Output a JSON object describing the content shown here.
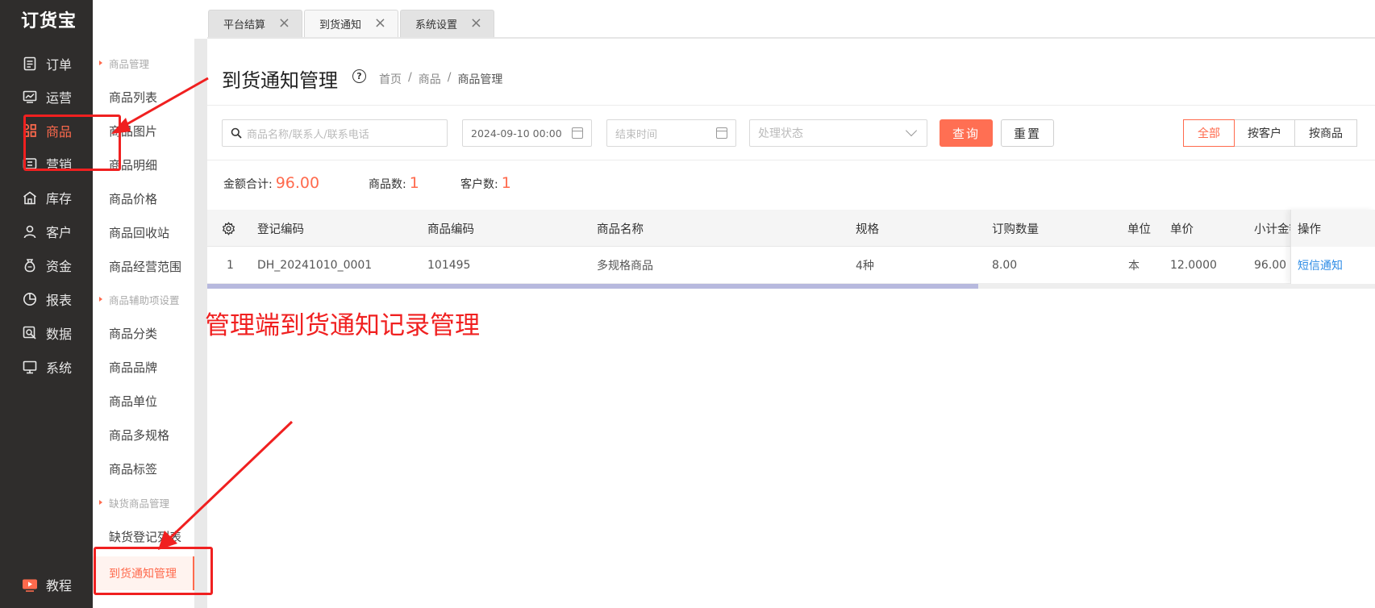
{
  "app": {
    "logo": "订货宝"
  },
  "rail": {
    "items": [
      {
        "label": "订单",
        "icon": "order-icon"
      },
      {
        "label": "运营",
        "icon": "chart-icon"
      },
      {
        "label": "商品",
        "icon": "grid-icon",
        "active": true
      },
      {
        "label": "营销",
        "icon": "marketing-icon"
      },
      {
        "label": "库存",
        "icon": "warehouse-icon"
      },
      {
        "label": "客户",
        "icon": "user-icon"
      },
      {
        "label": "资金",
        "icon": "money-bag-icon"
      },
      {
        "label": "报表",
        "icon": "pie-icon"
      },
      {
        "label": "数据",
        "icon": "data-search-icon"
      },
      {
        "label": "系统",
        "icon": "monitor-icon"
      }
    ],
    "tutorial": {
      "label": "教程",
      "icon": "video-icon"
    }
  },
  "submenu": {
    "group1": "商品管理",
    "group1_items": [
      "商品列表",
      "商品图片",
      "商品明细",
      "商品价格",
      "商品回收站",
      "商品经营范围"
    ],
    "group2": "商品辅助项设置",
    "group2_items": [
      "商品分类",
      "商品品牌",
      "商品单位",
      "商品多规格",
      "商品标签"
    ],
    "group3": "缺货商品管理",
    "group3_items": [
      "缺货登记列表",
      "到货通知管理"
    ],
    "active": "到货通知管理"
  },
  "tabs": [
    {
      "label": "平台结算"
    },
    {
      "label": "到货通知",
      "active": true
    },
    {
      "label": "系统设置"
    }
  ],
  "page": {
    "title": "到货通知管理",
    "breadcrumb": [
      "首页",
      "商品",
      "商品管理"
    ]
  },
  "filters": {
    "search_placeholder": "商品名称/联系人/联系电话",
    "start_time": "2024-09-10 00:00",
    "end_placeholder": "结束时间",
    "status_placeholder": "处理状态",
    "query_label": "查询",
    "reset_label": "重置",
    "segments": [
      "全部",
      "按客户",
      "按商品"
    ],
    "segment_active": "全部"
  },
  "stats": {
    "amount_label": "金额合计:",
    "amount_value": "96.00",
    "goods_label": "商品数:",
    "goods_value": "1",
    "customers_label": "客户数:",
    "customers_value": "1"
  },
  "table": {
    "headers": {
      "code": "登记编码",
      "goods_code": "商品编码",
      "goods_name": "商品名称",
      "spec": "规格",
      "qty": "订购数量",
      "unit": "单位",
      "price": "单价",
      "subtotal": "小计金额",
      "action": "操作"
    },
    "rows": [
      {
        "index": "1",
        "code": "DH_20241010_0001",
        "goods_code": "101495",
        "goods_name": "多规格商品",
        "spec": "4种",
        "qty": "8.00",
        "unit": "本",
        "price": "12.0000",
        "subtotal": "96.00",
        "action": "短信通知"
      }
    ],
    "scroll_fraction": 0.66
  },
  "annotation": {
    "caption": "管理端到货通知记录管理",
    "color": "#f02020"
  },
  "colors": {
    "accent": "#ff6a4d",
    "rail_bg": "#2f2d2c",
    "link": "#2f8de6"
  }
}
